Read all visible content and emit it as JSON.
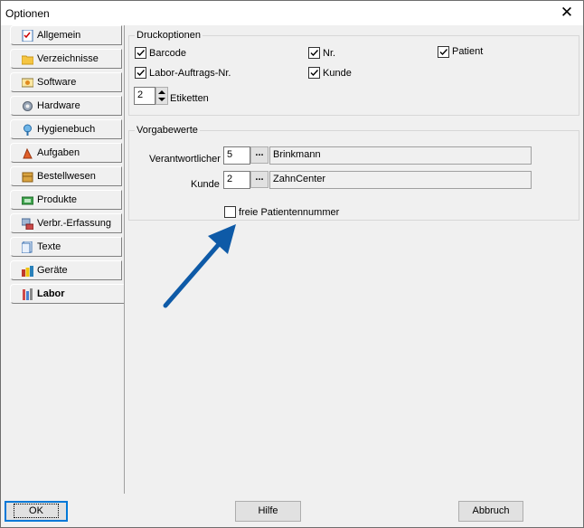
{
  "window": {
    "title": "Optionen"
  },
  "tabs": [
    {
      "label": "Allgemein",
      "icon": "checklist-icon"
    },
    {
      "label": "Verzeichnisse",
      "icon": "folder-icon"
    },
    {
      "label": "Software",
      "icon": "software-icon"
    },
    {
      "label": "Hardware",
      "icon": "gear-icon"
    },
    {
      "label": "Hygienebuch",
      "icon": "hygiene-icon"
    },
    {
      "label": "Aufgaben",
      "icon": "tasks-icon"
    },
    {
      "label": "Bestellwesen",
      "icon": "package-icon"
    },
    {
      "label": "Produkte",
      "icon": "products-icon"
    },
    {
      "label": "Verbr.-Erfassung",
      "icon": "consumption-icon"
    },
    {
      "label": "Texte",
      "icon": "text-document-icon"
    },
    {
      "label": "Geräte",
      "icon": "devices-icon"
    },
    {
      "label": "Labor",
      "icon": "lab-icon"
    }
  ],
  "active_tab": "Labor",
  "druckoptionen": {
    "title": "Druckoptionen",
    "barcode": {
      "label": "Barcode",
      "checked": true
    },
    "nr": {
      "label": "Nr.",
      "checked": true
    },
    "patient": {
      "label": "Patient",
      "checked": true
    },
    "labor_auftrags_nr": {
      "label": "Labor-Auftrags-Nr.",
      "checked": true
    },
    "kunde": {
      "label": "Kunde",
      "checked": true
    },
    "etiketten": {
      "value": "2",
      "label": "Etiketten"
    }
  },
  "vorgabewerte": {
    "title": "Vorgabewerte",
    "verantwortlicher": {
      "label": "Verantwortlicher",
      "code": "5",
      "name": "Brinkmann"
    },
    "kunde": {
      "label": "Kunde",
      "code": "2",
      "name": "ZahnCenter"
    },
    "dots_label": "...",
    "freie_patientennummer": {
      "label": "freie Patientennummer",
      "checked": false
    }
  },
  "buttons": {
    "ok": "OK",
    "hilfe": "Hilfe",
    "abbruch": "Abbruch"
  },
  "annotation": {
    "arrow_color": "#0e5aa7"
  }
}
